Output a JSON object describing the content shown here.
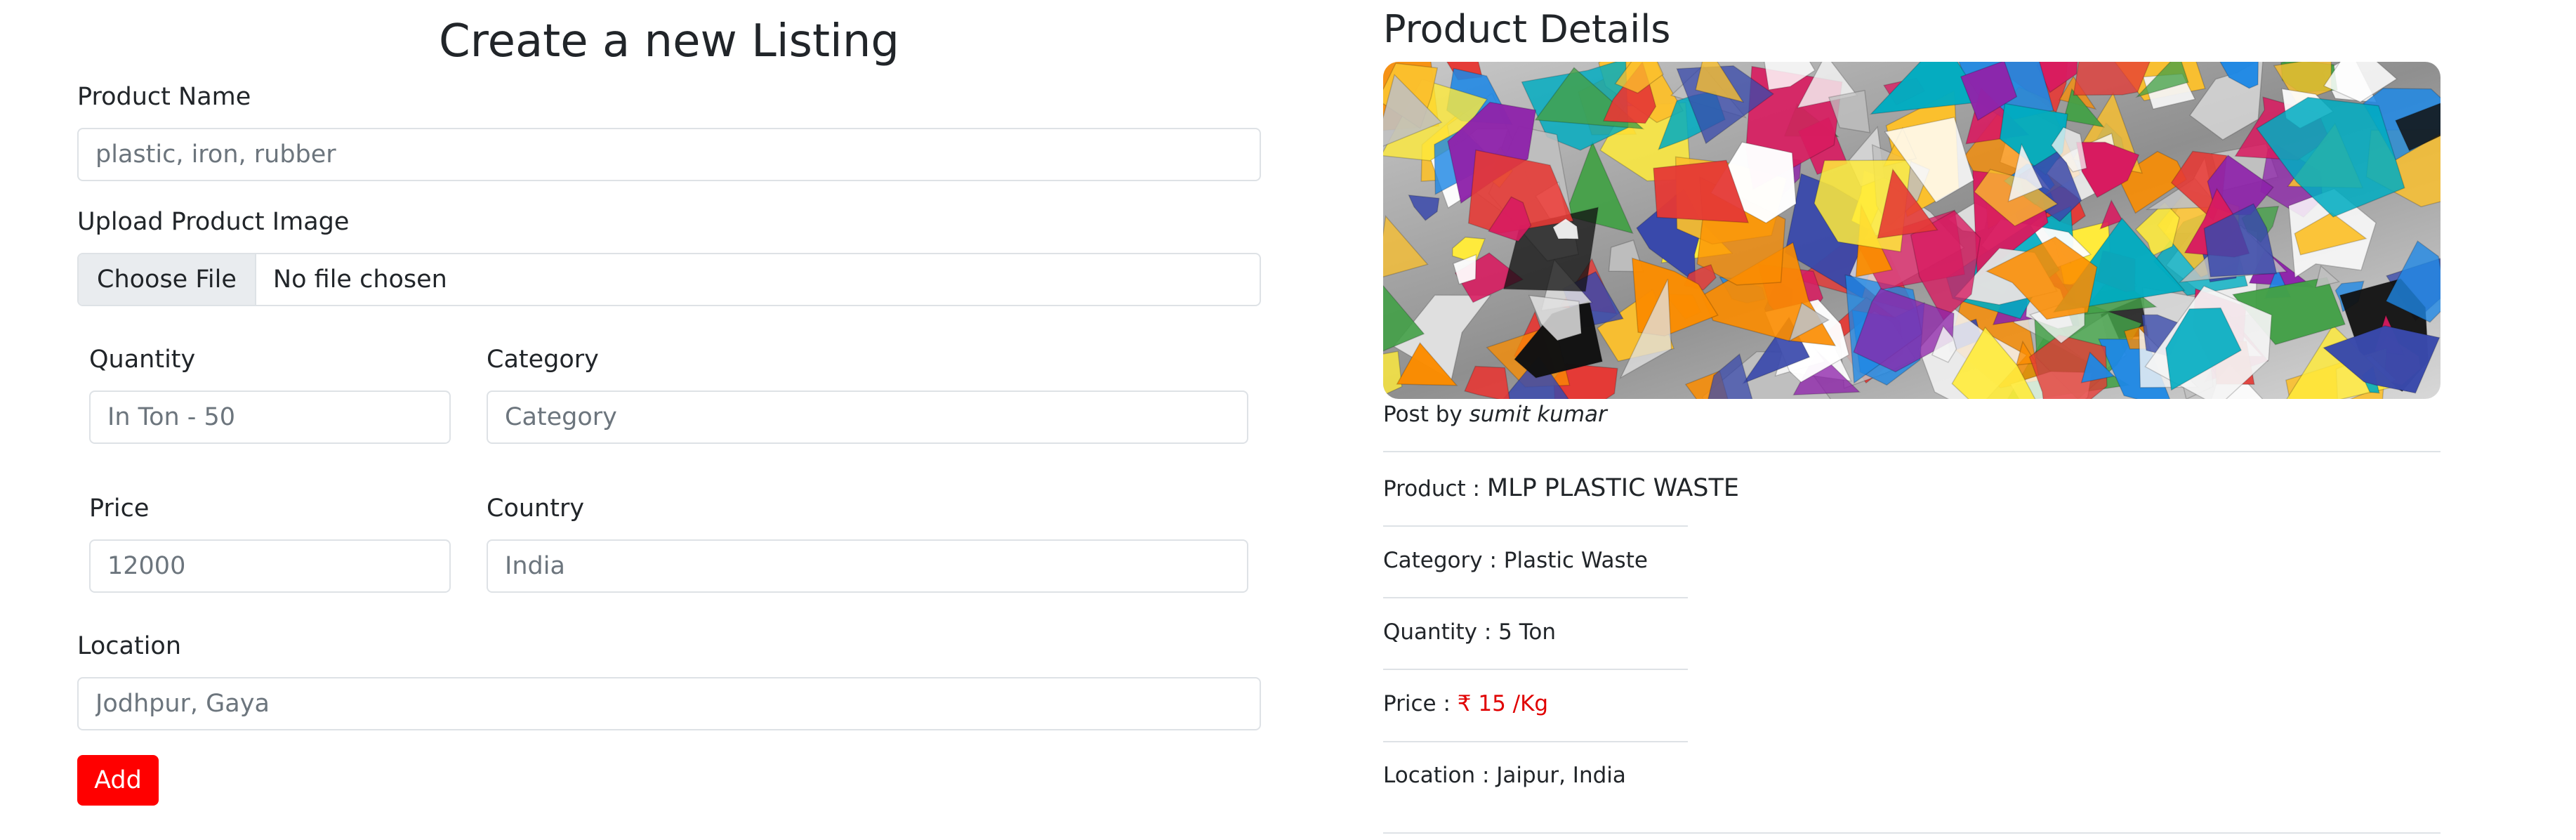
{
  "form": {
    "title": "Create a new Listing",
    "product_name": {
      "label": "Product Name",
      "placeholder": "plastic, iron, rubber"
    },
    "upload": {
      "label": "Upload Product Image",
      "button": "Choose File",
      "status": "No file chosen"
    },
    "quantity": {
      "label": "Quantity",
      "placeholder": "In Ton - 50"
    },
    "category": {
      "label": "Category",
      "placeholder": "Category"
    },
    "price": {
      "label": "Price",
      "placeholder": "12000"
    },
    "country": {
      "label": "Country",
      "placeholder": "India"
    },
    "location": {
      "label": "Location",
      "placeholder": "Jodhpur, Gaya"
    },
    "add_label": "Add",
    "accent_color": "#ff0000"
  },
  "details": {
    "title": "Product Details",
    "posted_prefix": "Post by",
    "posted_by": "sumit kumar",
    "product_label": "Product :",
    "product_value": "MLP PLASTIC WASTE",
    "category_label": "Category :",
    "category_value": "Plastic Waste",
    "quantity_label": "Quantity :",
    "quantity_value": "5 Ton",
    "price_label": "Price :",
    "price_value": "₹ 15 /Kg",
    "location_label": "Location :",
    "location_value": "Jaipur, India",
    "price_color": "#e00000"
  }
}
